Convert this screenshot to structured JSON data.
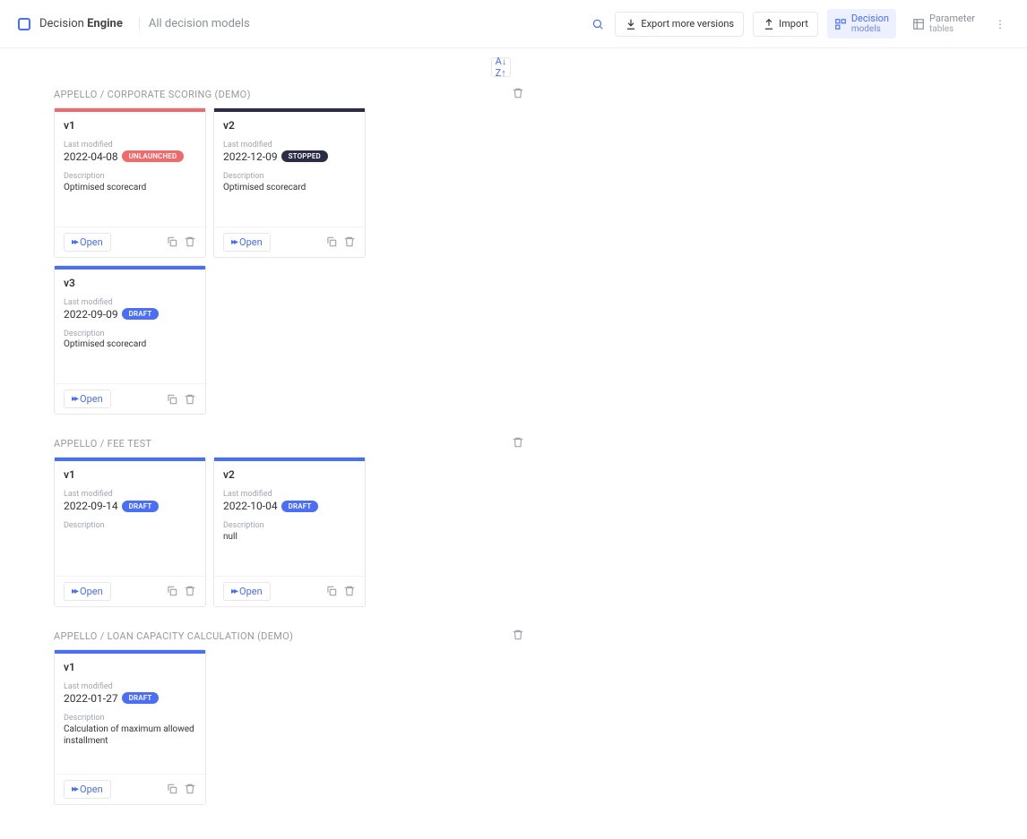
{
  "header": {
    "brand1": "Decision",
    "brand2": "Engine",
    "subtitle": "All decision models",
    "export_label": "Export more versions",
    "import_label": "Import",
    "tab1_line1": "Decision",
    "tab1_line2": "models",
    "tab2_line1": "Parameter",
    "tab2_line2": "tables"
  },
  "groups": [
    {
      "title": "APPELLO / CORPORATE SCORING (DEMO)",
      "cards": [
        {
          "version": "v1",
          "last_modified_label": "Last modified",
          "date": "2022-04-08",
          "badge": "UNLAUNCHED",
          "badge_color": "red",
          "desc_label": "Description",
          "desc": "Optimised scorecard",
          "open_label": "Open"
        },
        {
          "version": "v2",
          "last_modified_label": "Last modified",
          "date": "2022-12-09",
          "badge": "STOPPED",
          "badge_color": "dark",
          "desc_label": "Description",
          "desc": "Optimised scorecard",
          "open_label": "Open"
        },
        {
          "version": "v3",
          "last_modified_label": "Last modified",
          "date": "2022-09-09",
          "badge": "DRAFT",
          "badge_color": "blue",
          "desc_label": "Description",
          "desc": "Optimised scorecard",
          "open_label": "Open"
        }
      ]
    },
    {
      "title": "APPELLO / FEE TEST",
      "cards": [
        {
          "version": "v1",
          "last_modified_label": "Last modified",
          "date": "2022-09-14",
          "badge": "DRAFT",
          "badge_color": "blue",
          "desc_label": "Description",
          "desc": "",
          "open_label": "Open"
        },
        {
          "version": "v2",
          "last_modified_label": "Last modified",
          "date": "2022-10-04",
          "badge": "DRAFT",
          "badge_color": "blue",
          "desc_label": "Description",
          "desc": "null",
          "open_label": "Open"
        }
      ]
    },
    {
      "title": "APPELLO / LOAN CAPACITY CALCULATION (DEMO)",
      "cards": [
        {
          "version": "v1",
          "last_modified_label": "Last modified",
          "date": "2022-01-27",
          "badge": "DRAFT",
          "badge_color": "blue",
          "desc_label": "Description",
          "desc": "Calculation of maximum allowed installment",
          "open_label": "Open"
        }
      ]
    }
  ]
}
